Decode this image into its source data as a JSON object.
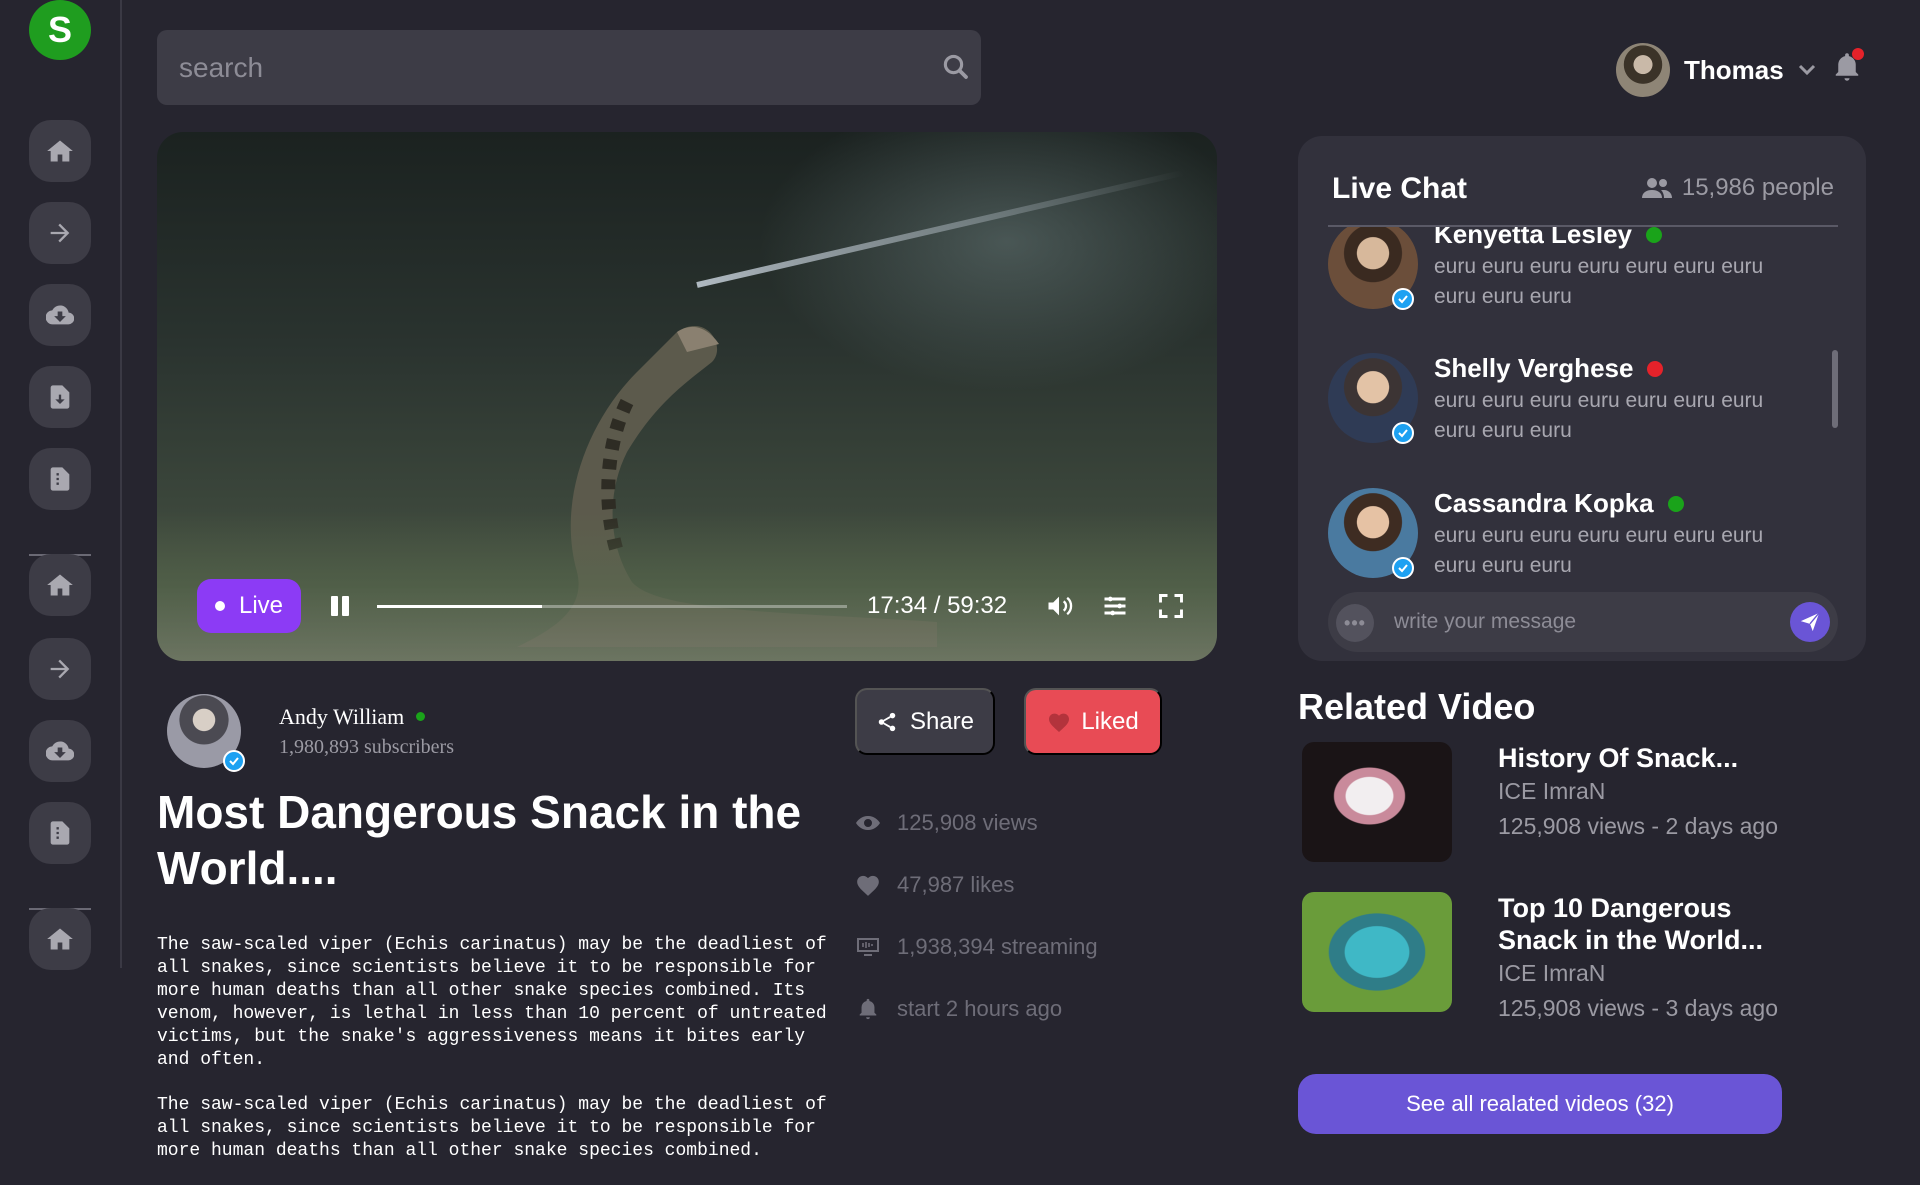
{
  "logo": {
    "letter": "S"
  },
  "search": {
    "placeholder": "search"
  },
  "user": {
    "name": "Thomas"
  },
  "colors": {
    "accent": "#6a55d6",
    "live": "#8c3bf5",
    "liked": "#e84b55",
    "online": "#1aa31a",
    "busy": "#e5222a",
    "notification": "#e5222a"
  },
  "sidebar": {
    "items": [
      {
        "icon": "home-icon"
      },
      {
        "icon": "arrow-right-icon"
      },
      {
        "icon": "cloud-download-icon"
      },
      {
        "icon": "file-download-icon"
      },
      {
        "icon": "file-icon"
      },
      {
        "icon": "home-icon"
      },
      {
        "icon": "arrow-right-icon"
      },
      {
        "icon": "cloud-download-icon"
      },
      {
        "icon": "file-icon"
      },
      {
        "icon": "home-icon"
      }
    ]
  },
  "player": {
    "live_label": "Live",
    "time": "17:34 / 59:32",
    "progress": 0.35
  },
  "channel": {
    "name": "Andy William",
    "subscribers": "1,980,893 subscribers"
  },
  "actions": {
    "share_label": "Share",
    "liked_label": "Liked"
  },
  "video": {
    "title": "Most Dangerous Snack in the World....",
    "description": [
      "The saw-scaled viper (Echis carinatus) may be the deadliest of all snakes, since scientists believe it to be responsible for more human deaths than all other snake species combined. Its venom, however, is lethal in less than 10 percent of untreated victims, but the snake's aggressiveness means it bites early and often.",
      "The saw-scaled viper (Echis carinatus) may be the deadliest of all snakes, since scientists believe it to be responsible for more human deaths than all other snake species combined."
    ]
  },
  "stats": {
    "views": "125,908 views",
    "likes": "47,987 likes",
    "streaming": "1,938,394 streaming",
    "started": "start 2 hours ago"
  },
  "chat": {
    "title": "Live Chat",
    "people": "15,986 people",
    "messages": [
      {
        "name": "Kenyetta Lesley",
        "status": "online",
        "text": "euru euru euru euru euru euru euru euru euru euru"
      },
      {
        "name": "Shelly Verghese",
        "status": "busy",
        "text": "euru euru euru euru euru euru euru euru euru euru"
      },
      {
        "name": "Cassandra Kopka",
        "status": "online",
        "text": "euru euru euru euru euru euru euru euru euru euru"
      }
    ],
    "input_placeholder": "write your message",
    "emoji_label": "•••"
  },
  "related": {
    "heading": "Related Video",
    "videos": [
      {
        "title": "History Of Snack...",
        "channel": "ICE ImraN",
        "meta": "125,908 views - 2 days ago"
      },
      {
        "title": "Top 10 Dangerous Snack in the World...",
        "channel": "ICE ImraN",
        "meta": "125,908 views - 3 days ago"
      }
    ],
    "see_all": "See all realated videos (32)"
  }
}
